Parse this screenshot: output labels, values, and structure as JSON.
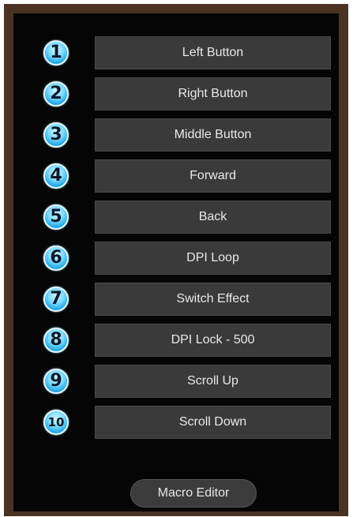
{
  "buttons": [
    {
      "number": "1",
      "label": "Left Button"
    },
    {
      "number": "2",
      "label": "Right Button"
    },
    {
      "number": "3",
      "label": "Middle Button"
    },
    {
      "number": "4",
      "label": "Forward"
    },
    {
      "number": "5",
      "label": "Back"
    },
    {
      "number": "6",
      "label": "DPI Loop"
    },
    {
      "number": "7",
      "label": "Switch Effect"
    },
    {
      "number": "8",
      "label": "DPI Lock - 500"
    },
    {
      "number": "9",
      "label": "Scroll Up"
    },
    {
      "number": "10",
      "label": "Scroll Down"
    }
  ],
  "macro_editor": {
    "label": "Macro Editor"
  },
  "colors": {
    "frame": "#4a3323",
    "background": "#050505",
    "button": "#3a3a3a",
    "badge": "#1da7e6",
    "text": "#e8e8e8"
  },
  "icons": {
    "badge": "numbered-circle-icon"
  }
}
